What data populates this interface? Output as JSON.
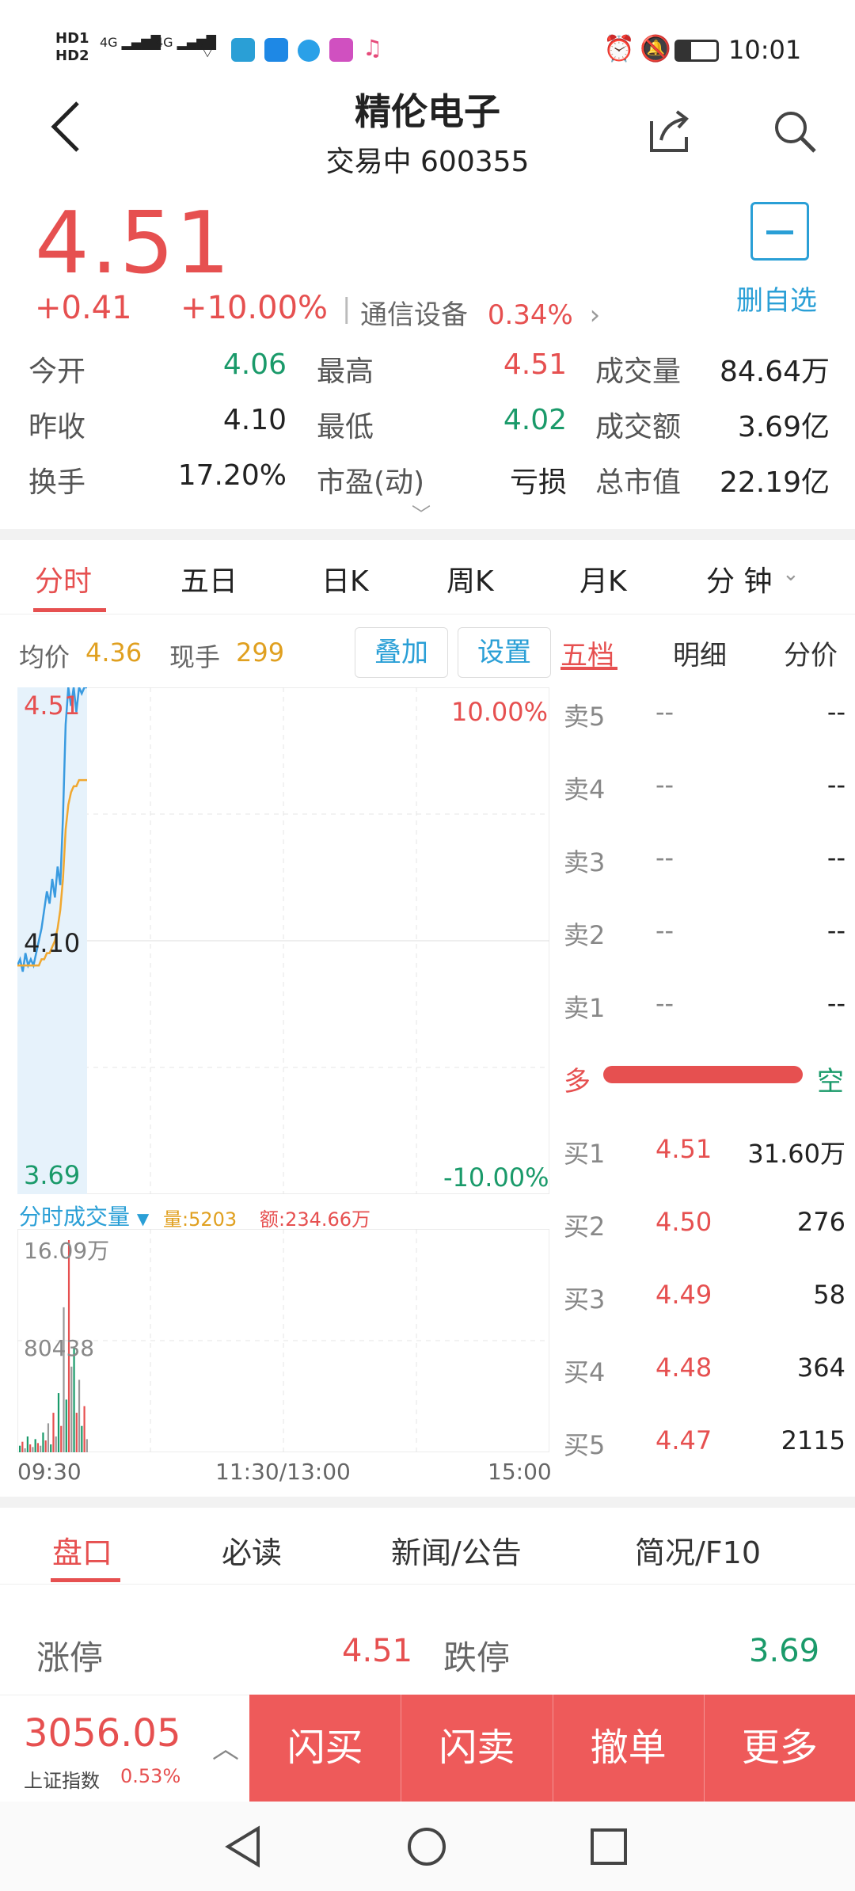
{
  "status_bar": {
    "time": "10:01",
    "hd1": "HD1",
    "hd2": "HD2",
    "net1": "4G",
    "net2": "4G"
  },
  "header": {
    "title": "精伦电子",
    "subtitle": "交易中 600355"
  },
  "quote": {
    "price": "4.51",
    "change": "+0.41",
    "change_pct": "+10.00%",
    "industry": "通信设备",
    "industry_pct": "0.34%",
    "remove_watch": "删自选"
  },
  "stats": [
    [
      {
        "label": "今开",
        "value": "4.06",
        "tone": "green"
      },
      {
        "label": "最高",
        "value": "4.51",
        "tone": "red"
      },
      {
        "label": "成交量",
        "value": "84.64万",
        "tone": "dark"
      }
    ],
    [
      {
        "label": "昨收",
        "value": "4.10",
        "tone": "dark"
      },
      {
        "label": "最低",
        "value": "4.02",
        "tone": "green"
      },
      {
        "label": "成交额",
        "value": "3.69亿",
        "tone": "dark"
      }
    ],
    [
      {
        "label": "换手",
        "value": "17.20%",
        "tone": "dark"
      },
      {
        "label": "市盈(动)",
        "value": "亏损",
        "tone": "dark"
      },
      {
        "label": "总市值",
        "value": "22.19亿",
        "tone": "dark"
      }
    ]
  ],
  "chart_tabs": [
    "分时",
    "五日",
    "日K",
    "周K",
    "月K",
    "分 钟"
  ],
  "intraday": {
    "avg_label": "均价",
    "avg_value": "4.36",
    "now_label": "现手",
    "now_value": "299",
    "overlay_btn": "叠加",
    "settings_btn": "设置",
    "top_price": "4.51",
    "mid_price": "4.10",
    "bottom_price": "3.69",
    "top_pct": "10.00%",
    "bottom_pct": "-10.00%",
    "vol_title": "分时成交量",
    "vol_amount": "量:5203",
    "vol_money": "额:234.66万",
    "vol_top": "16.09万",
    "vol_mid": "80438",
    "time_start": "09:30",
    "time_mid": "11:30/13:00",
    "time_end": "15:00"
  },
  "chart_data": {
    "type": "line",
    "series": [
      {
        "values": [
          4.06,
          4.07,
          4.05,
          4.08,
          4.06,
          4.07,
          4.06,
          4.08,
          4.1,
          4.12,
          4.15,
          4.18,
          4.16,
          4.2,
          4.17,
          4.22,
          4.19,
          4.3,
          4.45,
          4.51,
          4.48,
          4.51,
          4.47,
          4.51,
          4.5,
          4.51,
          4.51
        ]
      },
      {
        "values": [
          4.06,
          4.06,
          4.06,
          4.06,
          4.06,
          4.06,
          4.06,
          4.06,
          4.06,
          4.07,
          4.07,
          4.08,
          4.08,
          4.09,
          4.1,
          4.12,
          4.15,
          4.2,
          4.28,
          4.32,
          4.34,
          4.35,
          4.35,
          4.36,
          4.36,
          4.36,
          4.36
        ]
      }
    ],
    "volume": [
      5,
      8,
      3,
      12,
      6,
      4,
      10,
      7,
      5,
      15,
      9,
      22,
      6,
      30,
      12,
      45,
      20,
      110,
      40,
      161,
      65,
      80,
      30,
      55,
      20,
      35,
      10
    ],
    "ylim": [
      3.69,
      4.51
    ]
  },
  "orderbook_tabs": [
    "五档",
    "明细",
    "分价"
  ],
  "asks": [
    {
      "label": "卖5",
      "price": "--",
      "vol": "--"
    },
    {
      "label": "卖4",
      "price": "--",
      "vol": "--"
    },
    {
      "label": "卖3",
      "price": "--",
      "vol": "--"
    },
    {
      "label": "卖2",
      "price": "--",
      "vol": "--"
    },
    {
      "label": "卖1",
      "price": "--",
      "vol": "--"
    }
  ],
  "strength": {
    "left": "多",
    "right": "空"
  },
  "bids": [
    {
      "label": "买1",
      "price": "4.51",
      "vol": "31.60万"
    },
    {
      "label": "买2",
      "price": "4.50",
      "vol": "276"
    },
    {
      "label": "买3",
      "price": "4.49",
      "vol": "58"
    },
    {
      "label": "买4",
      "price": "4.48",
      "vol": "364"
    },
    {
      "label": "买5",
      "price": "4.47",
      "vol": "2115"
    }
  ],
  "bottom_tabs": [
    "盘口",
    "必读",
    "新闻/公告",
    "简况/F10"
  ],
  "limit": {
    "up_label": "涨停",
    "up_value": "4.51",
    "down_label": "跌停",
    "down_value": "3.69"
  },
  "index": {
    "value": "3056.05",
    "name": "上证指数",
    "pct": "0.53%"
  },
  "actions": [
    "闪买",
    "闪卖",
    "撤单",
    "更多"
  ],
  "colors": {
    "red": "#e65050",
    "green": "#1a9a6a",
    "blue": "#2a9fd6"
  }
}
